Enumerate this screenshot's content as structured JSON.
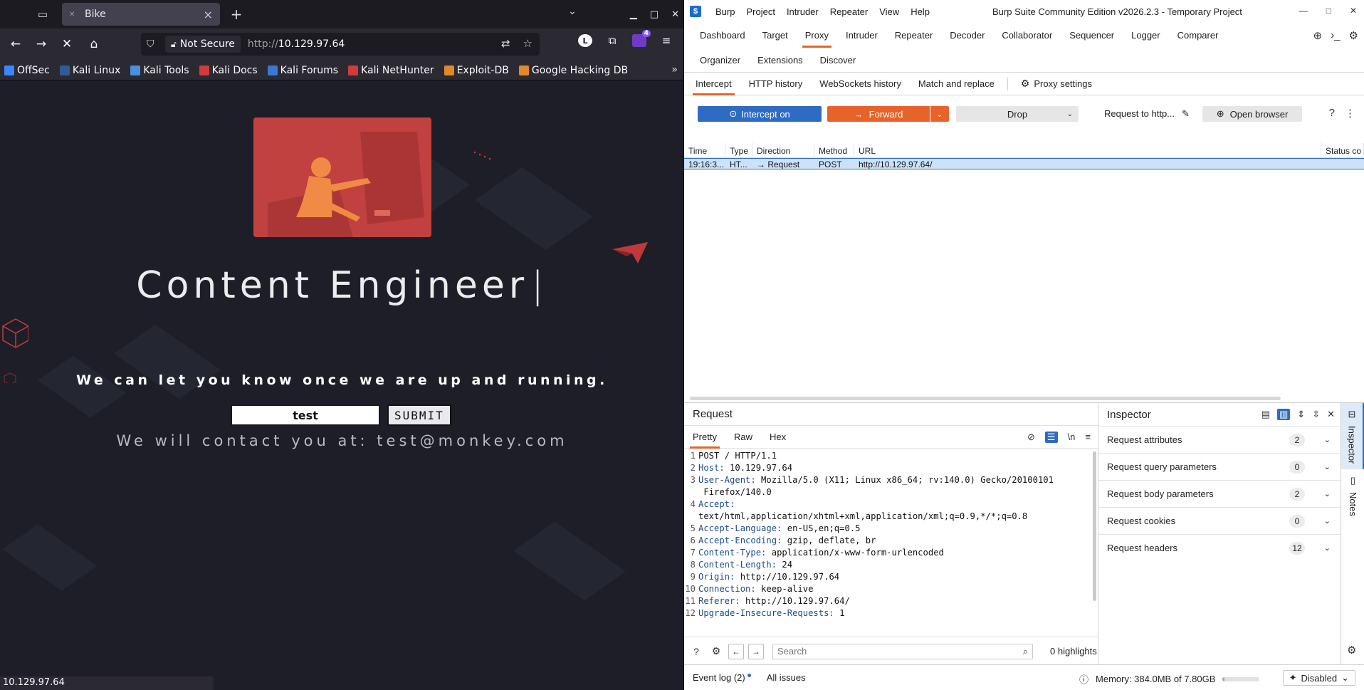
{
  "firefox": {
    "tab": {
      "title": "Bike"
    },
    "url": {
      "security_label": "Not Secure",
      "scheme": "http://",
      "host": "10.129.97.64"
    },
    "extension_badge": "4",
    "account_initial": "L",
    "bookmarks": [
      {
        "label": "OffSec",
        "color": "#3a86ff"
      },
      {
        "label": "Kali Linux",
        "color": "#2f5b9a"
      },
      {
        "label": "Kali Tools",
        "color": "#4a8fe0"
      },
      {
        "label": "Kali Docs",
        "color": "#d13b3b"
      },
      {
        "label": "Kali Forums",
        "color": "#3b78d1"
      },
      {
        "label": "Kali NetHunter",
        "color": "#d13b3b"
      },
      {
        "label": "Exploit-DB",
        "color": "#e0892b"
      },
      {
        "label": "Google Hacking DB",
        "color": "#e0892b"
      }
    ],
    "page": {
      "title": "Content Engineer",
      "caret": "|",
      "tagline": "We can let you know once we are up and running.",
      "email_value": "test",
      "submit_label": "SUBMIT",
      "contact_message": "We will contact you at: test@monkey.com"
    },
    "status_url": "10.129.97.64"
  },
  "burp": {
    "title": "Burp Suite Community Edition v2026.2.3 - Temporary Project",
    "menus": [
      "Burp",
      "Project",
      "Intruder",
      "Repeater",
      "View",
      "Help"
    ],
    "main_tabs_row1": [
      "Dashboard",
      "Target",
      "Proxy",
      "Intruder",
      "Repeater",
      "Decoder",
      "Collaborator",
      "Sequencer",
      "Logger",
      "Comparer"
    ],
    "main_tabs_row2": [
      "Organizer",
      "Extensions",
      "Discover"
    ],
    "active_main_tab": "Proxy",
    "proxy_tabs": [
      "Intercept",
      "HTTP history",
      "WebSockets history",
      "Match and replace"
    ],
    "proxy_settings_label": "Proxy settings",
    "actions": {
      "intercept": "Intercept on",
      "forward": "Forward",
      "drop": "Drop",
      "request_to": "Request to http...",
      "open_browser": "Open browser"
    },
    "table": {
      "columns": [
        "Time",
        "Type",
        "Direction",
        "Method",
        "URL",
        "Status co"
      ],
      "rows": [
        {
          "time": "19:16:3...",
          "type": "HT...",
          "direction": "Request",
          "method": "POST",
          "url": "http://10.129.97.64/"
        }
      ]
    },
    "request_panel": {
      "title": "Request",
      "tabs": [
        "Pretty",
        "Raw",
        "Hex"
      ],
      "lines": [
        {
          "n": "1",
          "name": "",
          "value": "POST / HTTP/1.1"
        },
        {
          "n": "2",
          "name": "Host:",
          "value": " 10.129.97.64"
        },
        {
          "n": "3",
          "name": "User-Agent:",
          "value": " Mozilla/5.0 (X11; Linux x86_64; rv:140.0) Gecko/20100101"
        },
        {
          "n": "",
          "name": "",
          "value": " Firefox/140.0"
        },
        {
          "n": "4",
          "name": "Accept:",
          "value": ""
        },
        {
          "n": "",
          "name": "",
          "value": "text/html,application/xhtml+xml,application/xml;q=0.9,*/*;q=0.8"
        },
        {
          "n": "5",
          "name": "Accept-Language:",
          "value": " en-US,en;q=0.5"
        },
        {
          "n": "6",
          "name": "Accept-Encoding:",
          "value": " gzip, deflate, br"
        },
        {
          "n": "7",
          "name": "Content-Type:",
          "value": " application/x-www-form-urlencoded"
        },
        {
          "n": "8",
          "name": "Content-Length:",
          "value": " 24"
        },
        {
          "n": "9",
          "name": "Origin:",
          "value": " http://10.129.97.64"
        },
        {
          "n": "10",
          "name": "Connection:",
          "value": " keep-alive"
        },
        {
          "n": "11",
          "name": "Referer:",
          "value": " http://10.129.97.64/"
        },
        {
          "n": "12",
          "name": "Upgrade-Insecure-Requests:",
          "value": " 1"
        }
      ],
      "search_placeholder": "Search",
      "highlights": "0 highlights"
    },
    "inspector": {
      "title": "Inspector",
      "sections": [
        {
          "label": "Request attributes",
          "count": "2"
        },
        {
          "label": "Request query parameters",
          "count": "0"
        },
        {
          "label": "Request body parameters",
          "count": "2"
        },
        {
          "label": "Request cookies",
          "count": "0"
        },
        {
          "label": "Request headers",
          "count": "12"
        }
      ],
      "rail": [
        "Inspector",
        "Notes"
      ]
    },
    "status_bar": {
      "event_log": "Event log (2)",
      "all_issues": "All issues",
      "memory": "Memory: 384.0MB of 7.80GB",
      "memory_used_fraction": 0.05,
      "ai_label": "Disabled"
    }
  }
}
